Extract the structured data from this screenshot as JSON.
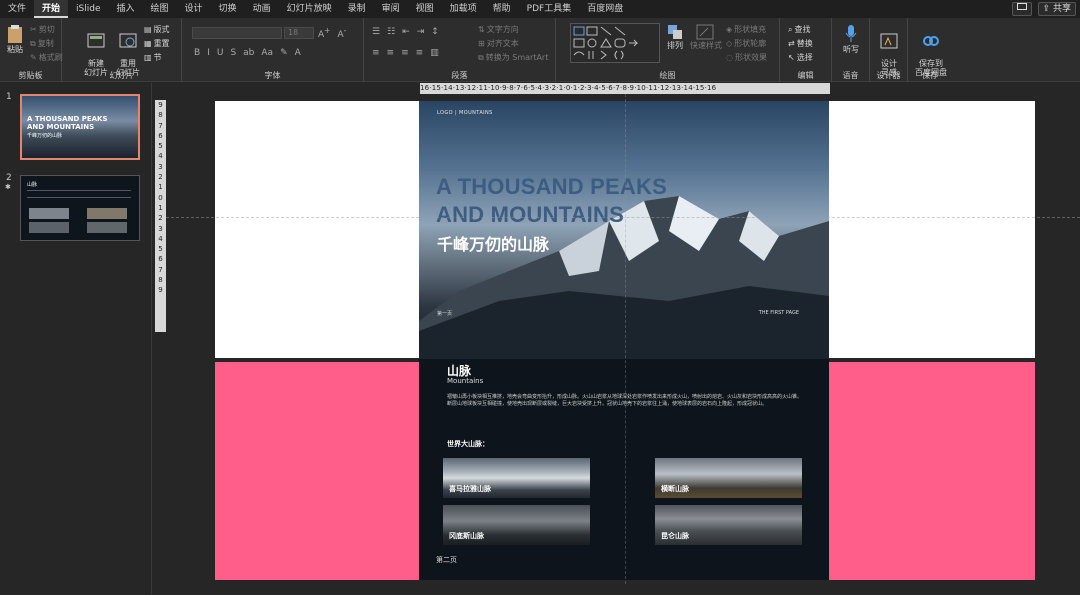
{
  "tabs": [
    "文件",
    "开始",
    "iSlide",
    "插入",
    "绘图",
    "设计",
    "切换",
    "动画",
    "幻灯片放映",
    "录制",
    "审阅",
    "视图",
    "加载项",
    "帮助",
    "PDF工具集",
    "百度网盘"
  ],
  "share_label": "共享",
  "ribbon": {
    "clipboard": {
      "label": "剪贴板",
      "paste": "粘贴",
      "cut": "剪切",
      "copy": "复制",
      "format_painter": "格式刷"
    },
    "slides": {
      "label": "幻灯片",
      "new_slide": "新建\n幻灯片",
      "reuse": "重用\n幻灯片",
      "layout": "版式",
      "reset": "重置",
      "section": "节"
    },
    "font": {
      "label": "字体",
      "size": "18"
    },
    "paragraph": {
      "label": "段落",
      "text_direction": "文字方向",
      "align_text": "对齐文本",
      "smartart": "转换为 SmartArt"
    },
    "drawing": {
      "label": "绘图",
      "arrange": "排列",
      "quick_styles": "快速样式",
      "shape_fill": "形状填充",
      "shape_outline": "形状轮廓",
      "shape_effects": "形状效果"
    },
    "editing": {
      "label": "编辑",
      "find": "查找",
      "replace": "替换",
      "select": "选择"
    },
    "voice": {
      "label": "语音",
      "dictate": "听写"
    },
    "designer": {
      "label": "设计器",
      "ideas": "设计\n灵感"
    },
    "save": {
      "label": "保存",
      "save_to": "保存到\n百度网盘"
    }
  },
  "thumbs": [
    {
      "num": "1"
    },
    {
      "num": "2"
    }
  ],
  "ruler_h": "16·15·14·13·12·11·10·9·8·7·6·5·4·3·2·1·0·1·2·3·4·5·6·7·8·9·10·11·12·13·14·15·16",
  "ruler_v": [
    "9",
    "8",
    "7",
    "6",
    "5",
    "4",
    "3",
    "2",
    "1",
    "0",
    "1",
    "2",
    "3",
    "4",
    "5",
    "6",
    "7",
    "8",
    "9"
  ],
  "poster": {
    "logo": "LOGO  |  MOUNTAINS",
    "title_en_1": "A THOUSAND PEAKS",
    "title_en_2": "AND MOUNTAINS",
    "title_cn": "千峰万仞的山脉",
    "page_left": "第一页",
    "page_right": "THE FIRST PAGE",
    "section_title": "山脉",
    "section_sub": "Mountains",
    "paragraph": "褶皱山再小板块相互推挤，地壳会弯曲变形抬升，形成山脉。火山山岩浆从地球深处岩浆作喷发出来形成火山，喷射出的熔岩、火山灰和岩块形成高高的火山锥。断层山地球板块互相碰撞，使地壳出现断层或裂缝，巨大岩块受挤上升。冠状山地壳下的岩浆往上涌，使地球表层的岩石向上隆起，形成冠状山。",
    "world_title": "世界大山脉：",
    "cards": [
      "喜马拉雅山脉",
      "横断山脉",
      "冈底斯山脉",
      "昆仑山脉"
    ],
    "page_no": "第二页"
  },
  "colors": {
    "accent": "#e4856c",
    "pink": "#ff5e8a",
    "title_blue": "#3d5c82"
  }
}
